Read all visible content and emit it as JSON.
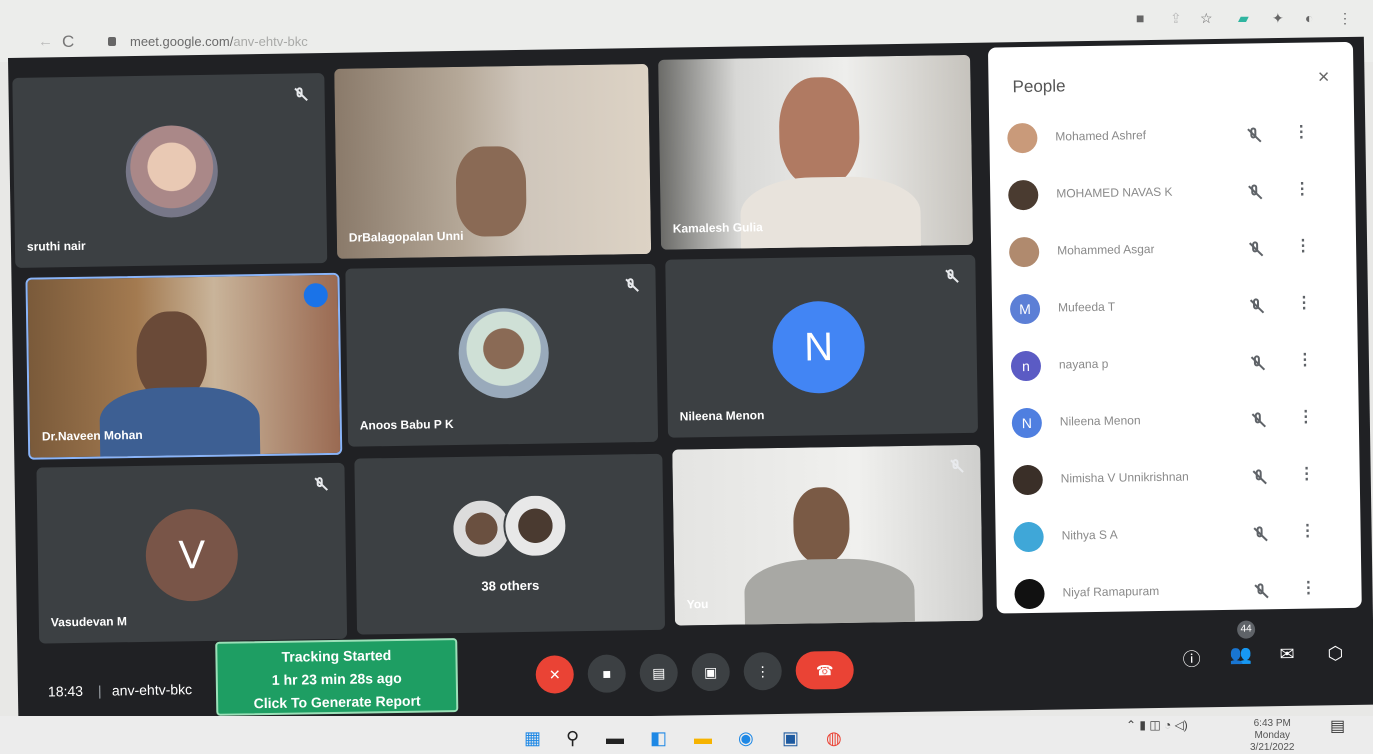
{
  "browser": {
    "url_host": "meet.google.com/",
    "url_path": "anv-ehtv-bkc"
  },
  "tiles": [
    {
      "name": "sruthi nair"
    },
    {
      "name": "DrBalagopalan Unni"
    },
    {
      "name": "Kamalesh Gulia"
    },
    {
      "name": "Dr.Naveen Mohan"
    },
    {
      "name": "Anoos Babu P K"
    },
    {
      "name": "Nileena Menon",
      "initial": "N"
    },
    {
      "name": "Vasudevan M",
      "initial": "V"
    },
    {
      "name": "38 others"
    },
    {
      "name": "You"
    }
  ],
  "people": {
    "title": "People",
    "close": "×",
    "list": [
      {
        "name": "Mohamed Ashref",
        "initial": "",
        "color": "#c99a7a"
      },
      {
        "name": "MOHAMED NAVAS K",
        "initial": "",
        "color": "#4a3b30"
      },
      {
        "name": "Mohammed Asgar",
        "initial": "",
        "color": "#b08a6e"
      },
      {
        "name": "Mufeeda T",
        "initial": "M",
        "color": "#5c7fd6"
      },
      {
        "name": "nayana p",
        "initial": "n",
        "color": "#5b5bc4"
      },
      {
        "name": "Nileena Menon",
        "initial": "N",
        "color": "#4f7fe0"
      },
      {
        "name": "Nimisha V Unnikrishnan",
        "initial": "",
        "color": "#3a2f28"
      },
      {
        "name": "Nithya S A",
        "initial": "",
        "color": "#3fa7d8"
      },
      {
        "name": "Niyaf Ramapuram",
        "initial": "",
        "color": "#111111"
      }
    ],
    "more": "⋮"
  },
  "bottom": {
    "time": "18:43",
    "code": "anv-ehtv-bkc",
    "tracking": [
      "Tracking Started",
      "1 hr 23 min 28s ago",
      "Click To Generate Report"
    ],
    "people_count": "44",
    "more": "⋮"
  },
  "taskbar": {
    "time": "6:43 PM",
    "day": "Monday",
    "date": "3/21/2022"
  }
}
